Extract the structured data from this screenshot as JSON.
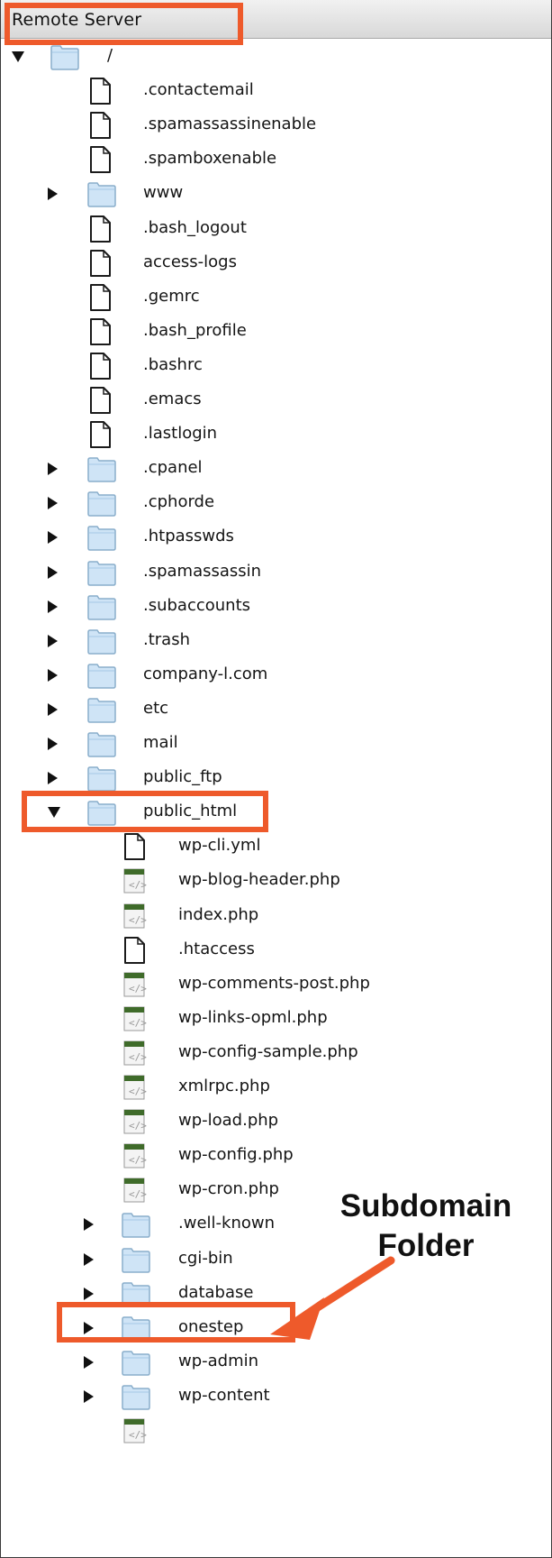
{
  "panel": {
    "title": "Remote Server"
  },
  "tree": [
    {
      "label": "/",
      "type": "folder",
      "expander": "expanded",
      "depth": 0
    },
    {
      "label": ".contactemail",
      "type": "file",
      "depth": 1
    },
    {
      "label": ".spamassassinenable",
      "type": "file",
      "depth": 1
    },
    {
      "label": ".spamboxenable",
      "type": "file",
      "depth": 1
    },
    {
      "label": "www",
      "type": "folder",
      "expander": "collapsed",
      "depth": 1
    },
    {
      "label": ".bash_logout",
      "type": "file",
      "depth": 1
    },
    {
      "label": "access-logs",
      "type": "file",
      "depth": 1
    },
    {
      "label": ".gemrc",
      "type": "file",
      "depth": 1
    },
    {
      "label": ".bash_profile",
      "type": "file",
      "depth": 1
    },
    {
      "label": ".bashrc",
      "type": "file",
      "depth": 1
    },
    {
      "label": ".emacs",
      "type": "file",
      "depth": 1
    },
    {
      "label": ".lastlogin",
      "type": "file",
      "depth": 1
    },
    {
      "label": ".cpanel",
      "type": "folder",
      "expander": "collapsed",
      "depth": 1
    },
    {
      "label": ".cphorde",
      "type": "folder",
      "expander": "collapsed",
      "depth": 1
    },
    {
      "label": ".htpasswds",
      "type": "folder",
      "expander": "collapsed",
      "depth": 1
    },
    {
      "label": ".spamassassin",
      "type": "folder",
      "expander": "collapsed",
      "depth": 1
    },
    {
      "label": ".subaccounts",
      "type": "folder",
      "expander": "collapsed",
      "depth": 1
    },
    {
      "label": ".trash",
      "type": "folder",
      "expander": "collapsed",
      "depth": 1
    },
    {
      "label": "company-l.com",
      "type": "folder",
      "expander": "collapsed",
      "depth": 1
    },
    {
      "label": "etc",
      "type": "folder",
      "expander": "collapsed",
      "depth": 1
    },
    {
      "label": "mail",
      "type": "folder",
      "expander": "collapsed",
      "depth": 1
    },
    {
      "label": "public_ftp",
      "type": "folder",
      "expander": "collapsed",
      "depth": 1
    },
    {
      "label": "public_html",
      "type": "folder",
      "expander": "expanded",
      "depth": 1
    },
    {
      "label": "wp-cli.yml",
      "type": "file",
      "depth": 2
    },
    {
      "label": "wp-blog-header.php",
      "type": "php",
      "depth": 2
    },
    {
      "label": "index.php",
      "type": "php",
      "depth": 2
    },
    {
      "label": ".htaccess",
      "type": "file",
      "depth": 2
    },
    {
      "label": "wp-comments-post.php",
      "type": "php",
      "depth": 2
    },
    {
      "label": "wp-links-opml.php",
      "type": "php",
      "depth": 2
    },
    {
      "label": "wp-config-sample.php",
      "type": "php",
      "depth": 2
    },
    {
      "label": "xmlrpc.php",
      "type": "php",
      "depth": 2
    },
    {
      "label": "wp-load.php",
      "type": "php",
      "depth": 2
    },
    {
      "label": "wp-config.php",
      "type": "php",
      "depth": 2
    },
    {
      "label": "wp-cron.php",
      "type": "php",
      "depth": 2
    },
    {
      "label": ".well-known",
      "type": "folder",
      "expander": "collapsed",
      "depth": 2
    },
    {
      "label": "cgi-bin",
      "type": "folder",
      "expander": "collapsed",
      "depth": 2
    },
    {
      "label": "database",
      "type": "folder",
      "expander": "collapsed",
      "depth": 2
    },
    {
      "label": "onestep",
      "type": "folder",
      "expander": "collapsed",
      "depth": 2
    },
    {
      "label": "wp-admin",
      "type": "folder",
      "expander": "collapsed",
      "depth": 2
    },
    {
      "label": "wp-content",
      "type": "folder",
      "expander": "collapsed",
      "depth": 2
    },
    {
      "label": "",
      "type": "php",
      "depth": 2
    }
  ],
  "annotation": {
    "callout_line1": "Subdomain",
    "callout_line2": "Folder",
    "accent_color": "#ee5a2b"
  },
  "colors": {
    "folder_fill": "#cfe4f6",
    "folder_stroke": "#8aaecb",
    "php_green": "#3f6b2a"
  }
}
